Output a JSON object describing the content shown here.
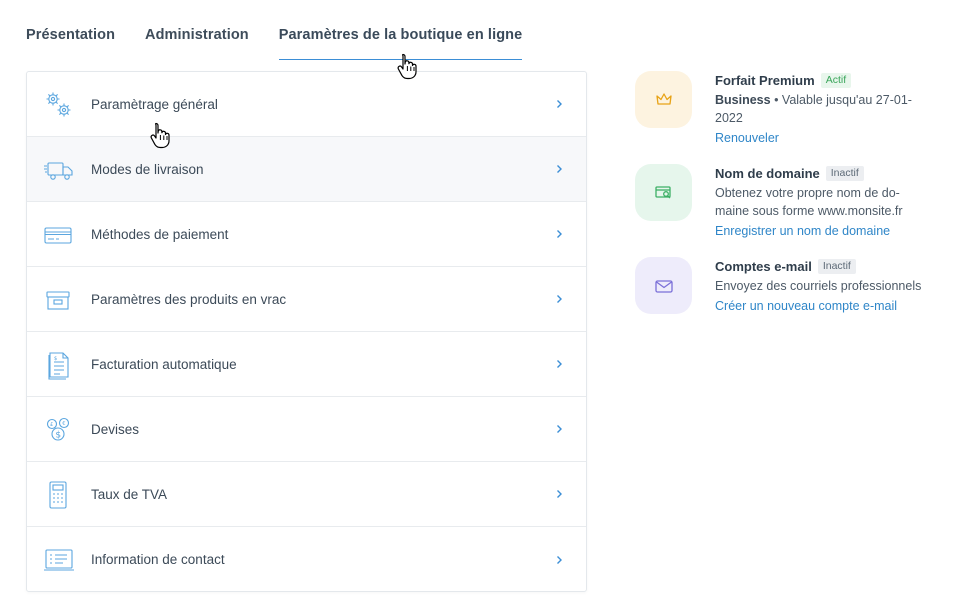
{
  "tabs": [
    {
      "label": "Présentation"
    },
    {
      "label": "Administration"
    },
    {
      "label": "Paramètres de la boutique en ligne"
    }
  ],
  "settings": {
    "items": [
      {
        "label": "Paramètrage général",
        "icon": "gears-icon"
      },
      {
        "label": "Modes de livraison",
        "icon": "truck-icon"
      },
      {
        "label": "Méthodes de paiement",
        "icon": "credit-card-icon"
      },
      {
        "label": "Paramètres des produits en vrac",
        "icon": "box-icon"
      },
      {
        "label": "Facturation automatique",
        "icon": "invoice-icon"
      },
      {
        "label": "Devises",
        "icon": "currency-coins-icon"
      },
      {
        "label": "Taux de TVA",
        "icon": "calculator-icon"
      },
      {
        "label": "Information de contact",
        "icon": "contact-card-icon"
      }
    ]
  },
  "panel": {
    "premium": {
      "title": "Forfait Premium",
      "status": "Actif",
      "plan": "Business",
      "validity": " • Valable jusqu'au 27-01-2022",
      "link": "Renouveler",
      "icon_bg": "#fdf3e0",
      "icon_color": "#e8a317"
    },
    "domain": {
      "title": "Nom de domaine",
      "status": "Inactif",
      "desc": "Obtenez votre propre nom de do-maine sous forme www.monsite.fr",
      "link": "Enregistrer un nom de domaine",
      "icon_bg": "#e6f6ec",
      "icon_color": "#3cb065"
    },
    "email": {
      "title": "Comptes e-mail",
      "status": "Inactif",
      "desc": "Envoyez des courriels professionnels",
      "link": "Créer un nouveau compte e-mail",
      "icon_bg": "#eeecfb",
      "icon_color": "#7a6fd8"
    }
  },
  "colors": {
    "accent": "#2f86c8",
    "icon_stroke": "#5ba6df",
    "active_tab_underline": "#3b8ed6"
  }
}
